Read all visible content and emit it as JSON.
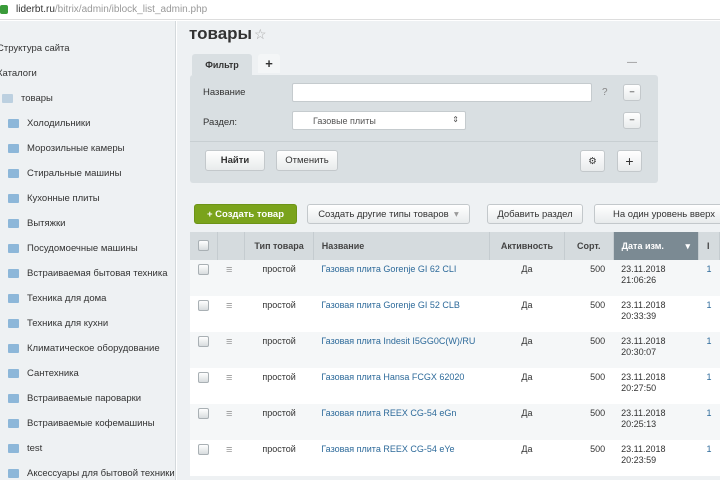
{
  "browser": {
    "domain": "liderbt.ru",
    "path": "/bitrix/admin/iblock_list_admin.php"
  },
  "sidebar": {
    "items": [
      {
        "label": "Структура сайта",
        "indent": 0
      },
      {
        "label": "Каталоги",
        "indent": 0
      },
      {
        "label": "товары",
        "indent": 1
      },
      {
        "label": "Холодильники",
        "indent": 2
      },
      {
        "label": "Морозильные камеры",
        "indent": 2
      },
      {
        "label": "Стиральные машины",
        "indent": 2
      },
      {
        "label": "Кухонные плиты",
        "indent": 2
      },
      {
        "label": "Вытяжки",
        "indent": 2
      },
      {
        "label": "Посудомоечные машины",
        "indent": 2
      },
      {
        "label": "Встраиваемая бытовая техника",
        "indent": 2
      },
      {
        "label": "Техника для дома",
        "indent": 2
      },
      {
        "label": "Техника для кухни",
        "indent": 2
      },
      {
        "label": "Климатическое оборудование",
        "indent": 2
      },
      {
        "label": "Сантехника",
        "indent": 2
      },
      {
        "label": "Встраиваемые пароварки",
        "indent": 2
      },
      {
        "label": "Встраиваемые кофемашины",
        "indent": 2
      },
      {
        "label": "test",
        "indent": 2
      },
      {
        "label": "Аксессуары для бытовой техники",
        "indent": 2
      }
    ]
  },
  "page": {
    "title": "товары"
  },
  "filter": {
    "tab": "Фильтр",
    "add_tab": "+",
    "name_label": "Название",
    "name_value": "",
    "help": "?",
    "section_label": "Раздел:",
    "section_value": "Газовые плиты",
    "find": "Найти",
    "cancel": "Отменить",
    "minus": "−",
    "plus": "+"
  },
  "toolbar": {
    "create": "Создать товар",
    "other_types": "Создать другие типы товаров",
    "add_section": "Добавить раздел",
    "level_up": "На один уровень вверх"
  },
  "table": {
    "headers": [
      "Тип товара",
      "Название",
      "Активность",
      "Сорт.",
      "Дата изм.",
      "I"
    ],
    "rows": [
      {
        "type": "простой",
        "name": "Газовая плита Gorenje GI 62 CLI",
        "active": "Да",
        "sort": "500",
        "date": "23.11.2018",
        "time": "21:06:26",
        "id": "1"
      },
      {
        "type": "простой",
        "name": "Газовая плита Gorenje GI 52 CLB",
        "active": "Да",
        "sort": "500",
        "date": "23.11.2018",
        "time": "20:33:39",
        "id": "1"
      },
      {
        "type": "простой",
        "name": "Газовая плита Indesit I5GG0C(W)/RU",
        "active": "Да",
        "sort": "500",
        "date": "23.11.2018",
        "time": "20:30:07",
        "id": "1"
      },
      {
        "type": "простой",
        "name": "Газовая плита Hansa FCGX 62020",
        "active": "Да",
        "sort": "500",
        "date": "23.11.2018",
        "time": "20:27:50",
        "id": "1"
      },
      {
        "type": "простой",
        "name": "Газовая плита REEX CG-54 eGn",
        "active": "Да",
        "sort": "500",
        "date": "23.11.2018",
        "time": "20:25:13",
        "id": "1"
      },
      {
        "type": "простой",
        "name": "Газовая плита REEX CG-54 eYe",
        "active": "Да",
        "sort": "500",
        "date": "23.11.2018",
        "time": "20:23:59",
        "id": "1"
      }
    ]
  }
}
